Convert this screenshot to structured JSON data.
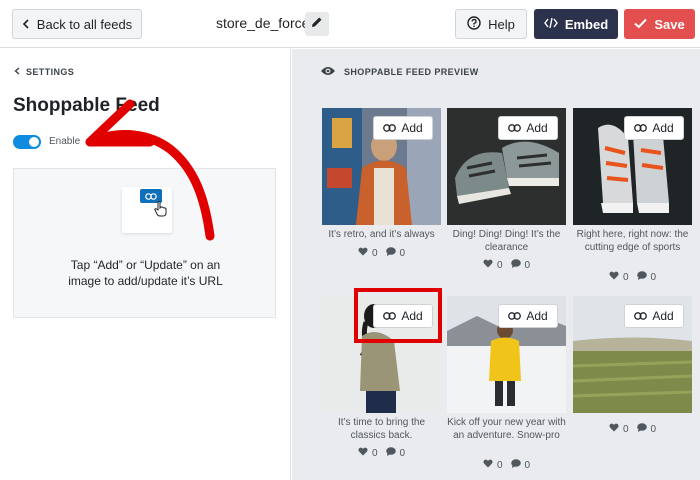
{
  "topbar": {
    "back_label": "Back to all feeds",
    "feed_name": "store_de_force",
    "help_label": "Help",
    "embed_label": "Embed",
    "save_label": "Save"
  },
  "sidebar": {
    "settings_label": "SETTINGS",
    "title": "Shoppable Feed",
    "toggle_label": "Enable",
    "toggle_on": true,
    "info_text": "Tap “Add” or “Update” on an image to add/update it’s URL"
  },
  "preview": {
    "header": "SHOPPABLE FEED PREVIEW",
    "add_label": "Add",
    "posts": [
      {
        "caption": "It’s retro, and it’s always",
        "likes": "0",
        "comments": "0"
      },
      {
        "caption": "Ding! Ding! Ding! It’s the clearance",
        "likes": "0",
        "comments": "0"
      },
      {
        "caption": "Right here, right now: the cutting edge of sports",
        "likes": "0",
        "comments": "0"
      },
      {
        "caption": "It’s time to bring the classics back.",
        "likes": "0",
        "comments": "0"
      },
      {
        "caption": "Kick off your new year with an adventure. Snow-pro",
        "likes": "0",
        "comments": "0"
      },
      {
        "caption": "",
        "likes": "0",
        "comments": "0"
      }
    ]
  },
  "colors": {
    "accent_blue": "#0f8be0",
    "embed_bg": "#2c324c",
    "save_bg": "#e34f4f",
    "highlight_red": "#e00000"
  }
}
